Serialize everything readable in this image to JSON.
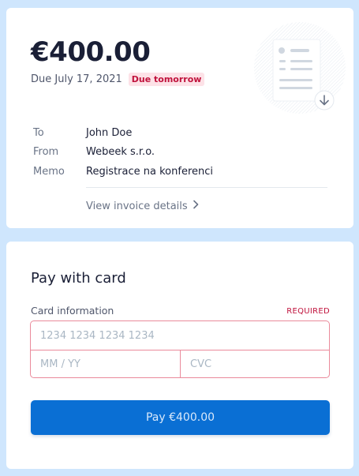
{
  "colors": {
    "background": "#cfe6fd",
    "card": "#ffffff",
    "accent": "#0a6fd4",
    "error": "#c0123c",
    "badge_bg": "#fde2e7"
  },
  "invoice": {
    "amount": "€400.00",
    "due_date": "Due July 17, 2021",
    "due_badge": "Due tomorrow",
    "illustration_icon": "invoice-document-download-icon",
    "details": [
      {
        "label": "To",
        "value": "John Doe"
      },
      {
        "label": "From",
        "value": "Webeek s.r.o."
      },
      {
        "label": "Memo",
        "value": "Registrace na konferenci"
      }
    ],
    "view_details_link": "View invoice details",
    "chevron_icon": "chevron-right-icon"
  },
  "payment": {
    "title": "Pay with card",
    "card_info_label": "Card information",
    "required_label": "REQUIRED",
    "card_number": {
      "value": "",
      "placeholder": "1234 1234 1234 1234"
    },
    "expiry": {
      "value": "",
      "placeholder": "MM / YY"
    },
    "cvc": {
      "value": "",
      "placeholder": "CVC"
    },
    "pay_button": "Pay €400.00"
  }
}
